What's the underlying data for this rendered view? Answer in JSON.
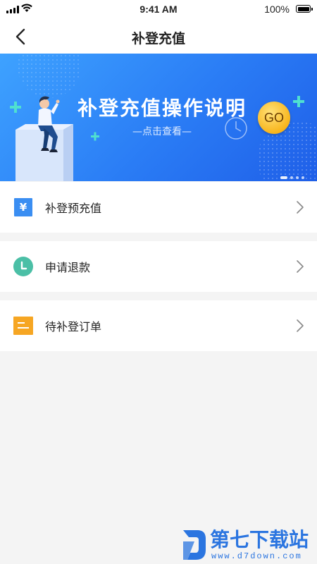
{
  "status_bar": {
    "time": "9:41 AM",
    "battery_pct": "100%",
    "icons": [
      "signal-icon",
      "wifi-icon",
      "battery-icon"
    ]
  },
  "nav": {
    "title": "补登充值",
    "back_icon": "chevron-left-icon"
  },
  "banner": {
    "title": "补登充值操作说明",
    "subtitle": "—点击查看—",
    "button_label": "GO",
    "page_indicator": {
      "count": 4,
      "active_index": 0
    },
    "colors": {
      "start": "#3ea2ff",
      "end": "#1f5fe8"
    }
  },
  "menu": {
    "items": [
      {
        "label": "补登预充值",
        "icon": "yen-icon",
        "icon_color": "#3a8ef2"
      },
      {
        "label": "申请退款",
        "icon": "clock-icon",
        "icon_color": "#4bbfa6"
      },
      {
        "label": "待补登订单",
        "icon": "list-icon",
        "icon_color": "#f6a623"
      }
    ],
    "chevron_icon": "chevron-right-icon"
  },
  "watermark": {
    "logo_text": "第七下载站",
    "url": "www.d7down.com"
  }
}
